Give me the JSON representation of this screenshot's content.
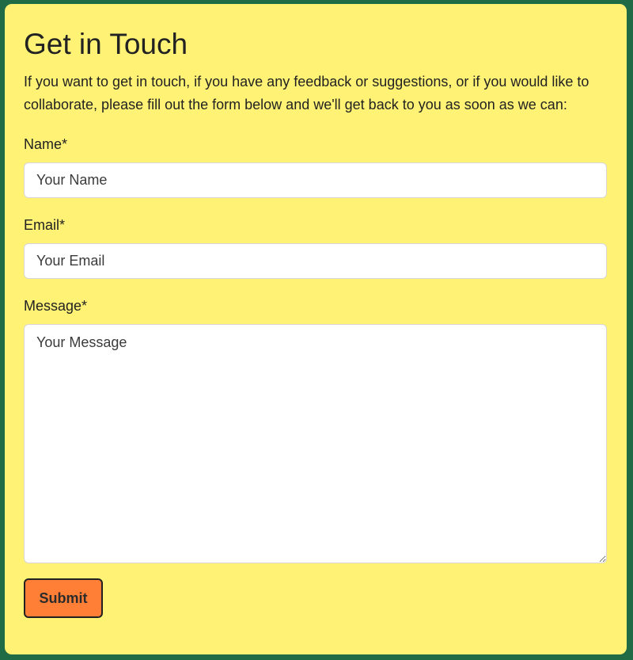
{
  "form": {
    "title": "Get in Touch",
    "intro": "If you want to get in touch, if you have any feedback or suggestions, or if you would like to collaborate, please fill out the form below and we'll get back to you as soon as we can:",
    "name": {
      "label": "Name*",
      "placeholder": "Your Name",
      "value": ""
    },
    "email": {
      "label": "Email*",
      "placeholder": "Your Email",
      "value": ""
    },
    "message": {
      "label": "Message*",
      "placeholder": "Your Message",
      "value": ""
    },
    "submit_label": "Submit"
  },
  "colors": {
    "page_background": "#1f6b45",
    "card_background": "#fff275",
    "submit_background": "#ff7f36"
  }
}
